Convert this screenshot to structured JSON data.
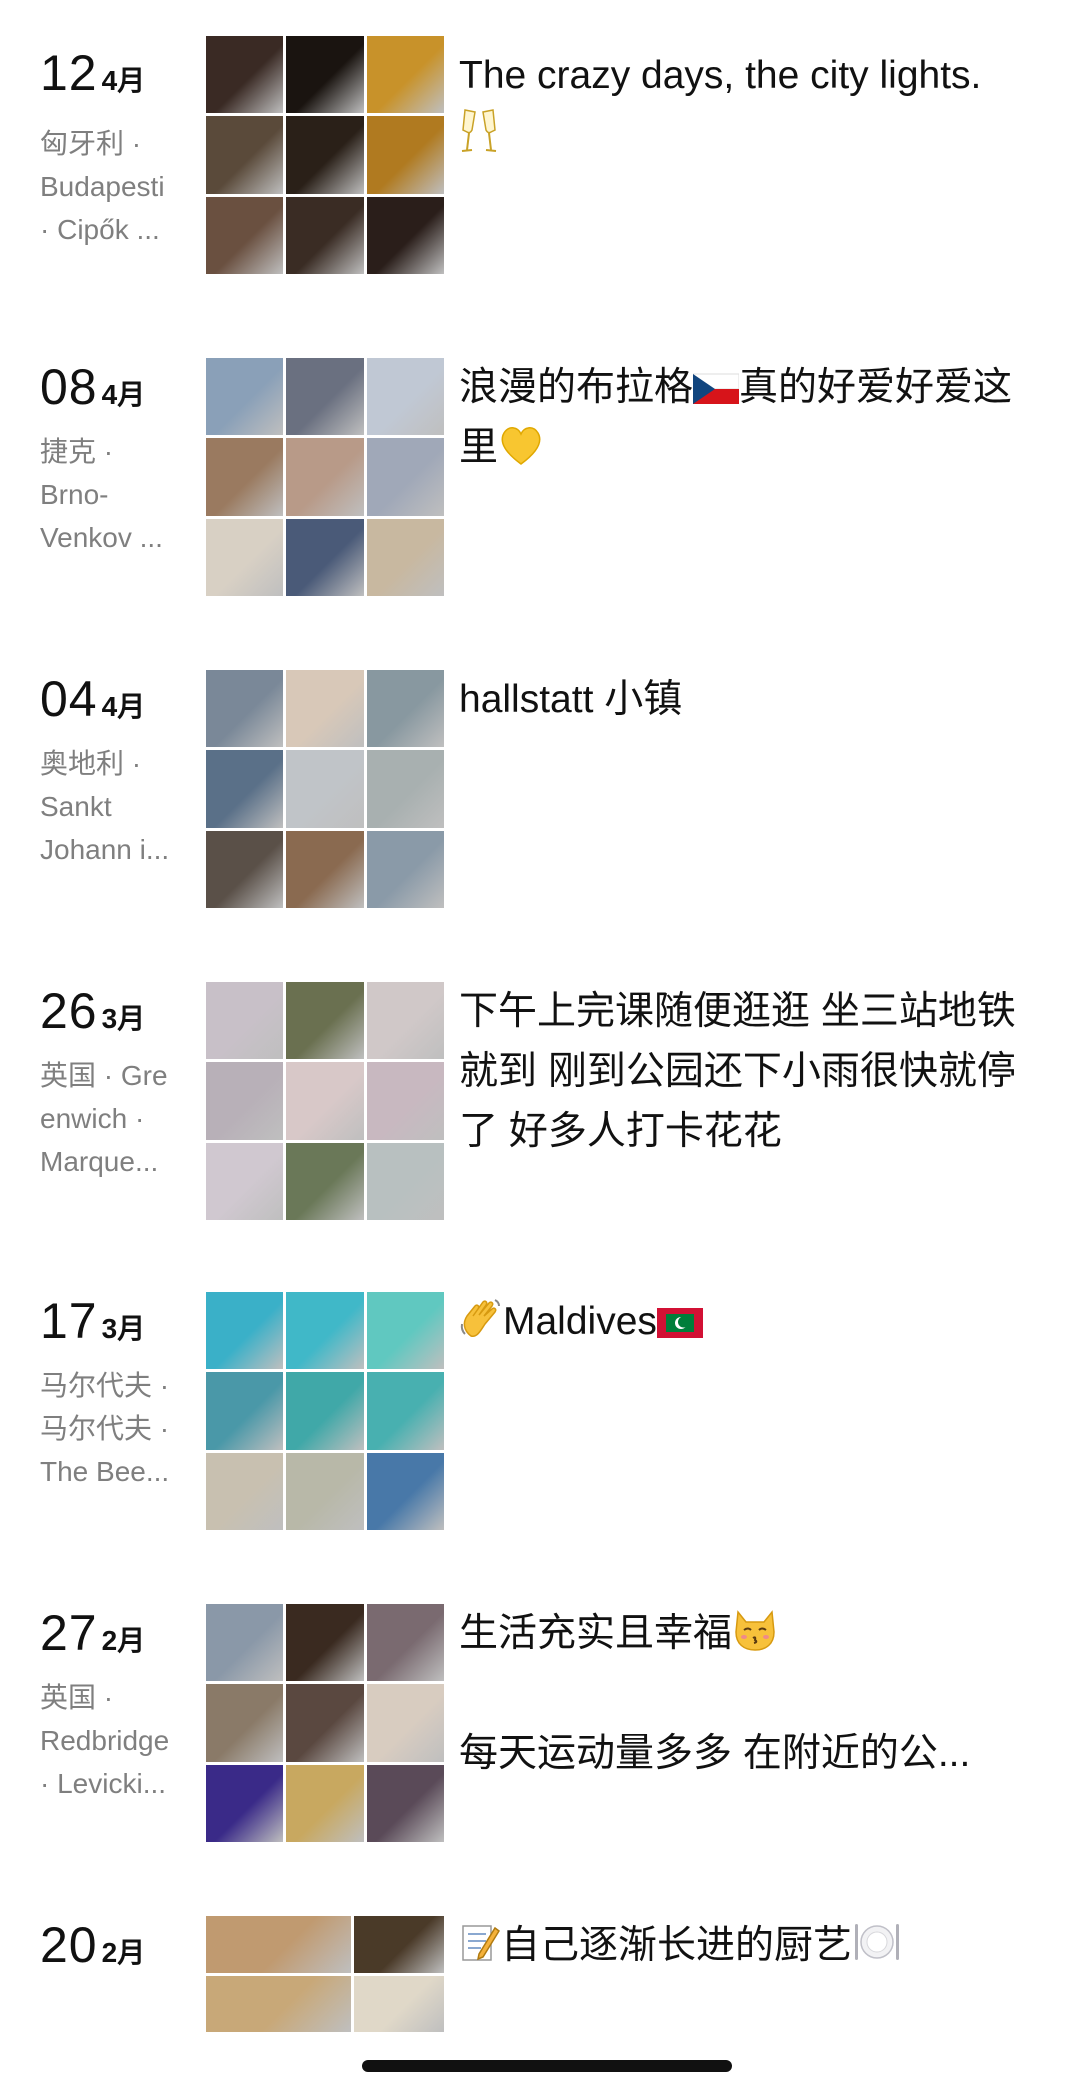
{
  "entries": [
    {
      "day": "12",
      "month": "4月",
      "location": [
        "匈牙利 ·",
        "Budapesti",
        " · Cipők ..."
      ],
      "caption": [
        "The crazy days, the city lights."
      ],
      "caption_emojis": [
        "champagne-glasses"
      ],
      "colors": [
        "#3a2a24",
        "#1a1410",
        "#c8922a",
        "#5a4a3a",
        "#2a2018",
        "#b07a20",
        "#6a5040",
        "#3a2c24",
        "#2a1e1a"
      ]
    },
    {
      "day": "08",
      "month": "4月",
      "location": [
        "捷克 ·",
        "Brno-",
        "Venkov ..."
      ],
      "caption": [
        "浪漫的布拉格",
        "真的好爱好爱这里"
      ],
      "caption_emojis": [
        "czech-flag",
        "yellow-heart"
      ],
      "colors": [
        "#8aa0b8",
        "#6a7080",
        "#c0c8d4",
        "#9a7a60",
        "#b89a88",
        "#a0a8b8",
        "#d8d0c4",
        "#4a5a78",
        "#c8b8a0"
      ]
    },
    {
      "day": "04",
      "month": "4月",
      "location": [
        "奥地利 ·",
        "Sankt",
        "Johann i..."
      ],
      "caption": [
        "hallstatt 小镇"
      ],
      "caption_emojis": [],
      "colors": [
        "#7a8898",
        "#d8c8b8",
        "#8898a0",
        "#5a7088",
        "#c0c4c8",
        "#a8b0b0",
        "#5a5048",
        "#8a6a50",
        "#8a9aa8"
      ]
    },
    {
      "day": "26",
      "month": "3月",
      "location": [
        "英国 · Gre",
        "enwich ·",
        "Marque..."
      ],
      "caption": [
        "下午上完课随便逛逛 坐三站地铁就到 刚到公园还下小雨很快就停了 好多人打卡花花"
      ],
      "caption_emojis": [],
      "colors": [
        "#c8c0c8",
        "#6a7050",
        "#d0c8c8",
        "#b8b0b8",
        "#d8c8c8",
        "#c8b8c0",
        "#d0c8d0",
        "#6a7858",
        "#b8c0c0"
      ]
    },
    {
      "day": "17",
      "month": "3月",
      "location": [
        "马尔代夫 ·",
        "马尔代夫 ·",
        "The Bee..."
      ],
      "caption": [
        "Maldives"
      ],
      "caption_emojis": [
        "waving-hand",
        "maldives-flag"
      ],
      "colors": [
        "#3ab0c8",
        "#40b8c8",
        "#60c8c0",
        "#4a98a8",
        "#40a8a8",
        "#48b0b0",
        "#c8c0b0",
        "#b8b8a8",
        "#4878a8"
      ]
    },
    {
      "day": "27",
      "month": "2月",
      "location": [
        "英国 ·",
        "Redbridge",
        " · Levicki..."
      ],
      "caption": [
        "生活充实且幸福",
        "每天运动量多多 在附近的公..."
      ],
      "caption_emojis": [
        "kissing-cat"
      ],
      "colors": [
        "#8a98a8",
        "#3a2a20",
        "#7a6a70",
        "#8a7a68",
        "#5a4840",
        "#d8ccc0",
        "#3a2a88",
        "#c8a860",
        "#5a4a58"
      ]
    },
    {
      "day": "20",
      "month": "2月",
      "location": [],
      "caption": [
        "自己逐渐长进的厨艺"
      ],
      "caption_emojis": [
        "memo",
        "plate-with-cutlery"
      ],
      "colors": [
        "#c09a70",
        "#4a3a28",
        "#c8a878",
        "#e0d8c8"
      ]
    }
  ]
}
